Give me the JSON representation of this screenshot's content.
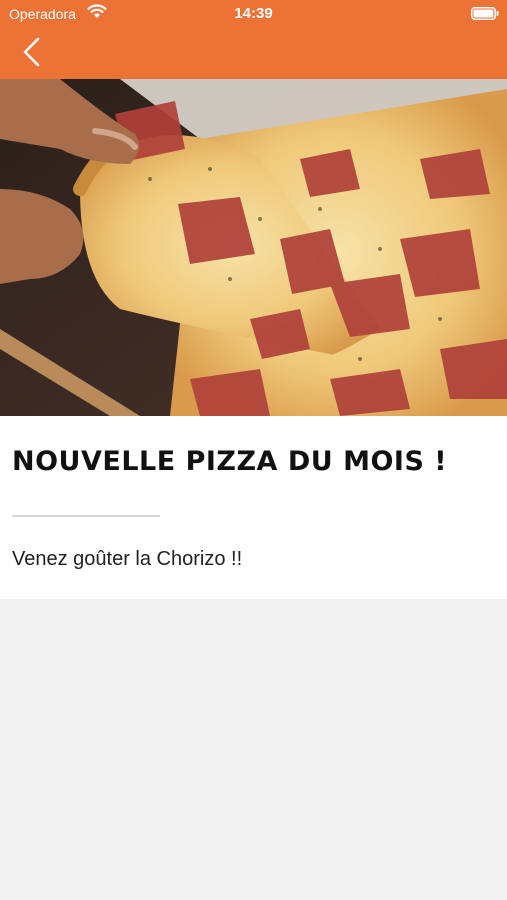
{
  "status_bar": {
    "carrier": "Operadora",
    "time": "14:39",
    "wifi_icon": "wifi-icon",
    "battery_icon": "battery-icon"
  },
  "nav": {
    "back_icon": "chevron-left-icon",
    "background_color": "#ed7236"
  },
  "hero_image": {
    "subject": "pizza slice"
  },
  "article": {
    "title": "Nouvelle pizza du mois !",
    "body": "Venez goûter la Chorizo !!"
  }
}
